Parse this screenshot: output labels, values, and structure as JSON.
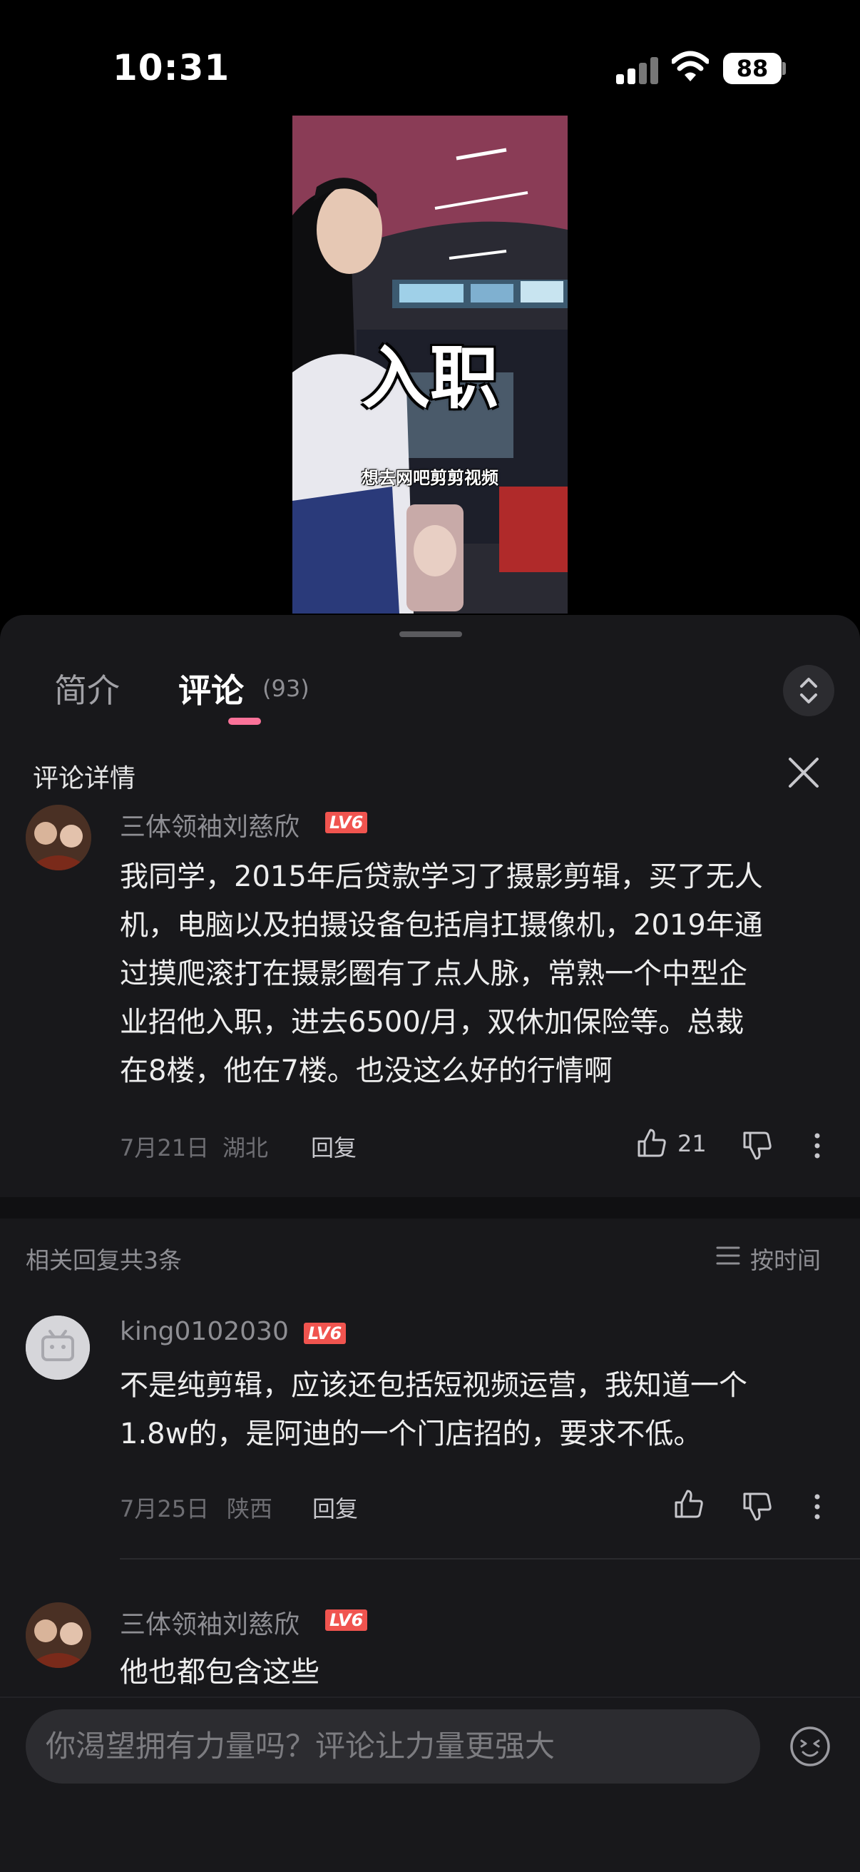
{
  "status_bar": {
    "time": "10:31",
    "battery": "88"
  },
  "video": {
    "caption_big": "入职",
    "caption_small": "想去网吧剪剪视频"
  },
  "tabs": {
    "intro": "简介",
    "comments": "评论",
    "comments_count": "(93)"
  },
  "comment_detail": {
    "title": "评论详情",
    "main": {
      "username": "三体领袖刘慈欣",
      "level": "LV6",
      "lines": [
        "我同学，2015年后贷款学习了摄影剪辑，买了无人",
        "机，电脑以及拍摄设备包括肩扛摄像机，2019年通",
        "过摸爬滚打在摄影圈有了点人脉，常熟一个中型企",
        "业招他入职，进去6500/月，双休加保险等。总裁",
        "在8楼，他在7楼。也没这么好的行情啊"
      ],
      "date": "7月21日",
      "location": "湖北",
      "reply_label": "回复",
      "likes": "21"
    },
    "related_label": "相关回复共3条",
    "sort_label": "按时间",
    "replies": [
      {
        "username": "king0102030",
        "level": "LV6",
        "lines": [
          "不是纯剪辑，应该还包括短视频运营，我知道一个",
          "1.8w的，是阿迪的一个门店招的，要求不低。"
        ],
        "date": "7月25日",
        "location": "陕西",
        "reply_label": "回复"
      },
      {
        "username": "三体领袖刘慈欣",
        "level": "LV6",
        "lines": [
          "他也都包含这些"
        ]
      }
    ]
  },
  "input": {
    "placeholder": "你渴望拥有力量吗？评论让力量更强大"
  },
  "colors": {
    "accent": "#fb7299",
    "level_badge": "#f0544f",
    "panel_bg": "#18181b"
  },
  "icons": [
    "signal-icon",
    "wifi-icon",
    "battery-icon",
    "expand-icon",
    "close-icon",
    "avatar",
    "thumb-up-icon",
    "thumb-down-icon",
    "more-icon",
    "sort-icon",
    "emoji-icon"
  ]
}
